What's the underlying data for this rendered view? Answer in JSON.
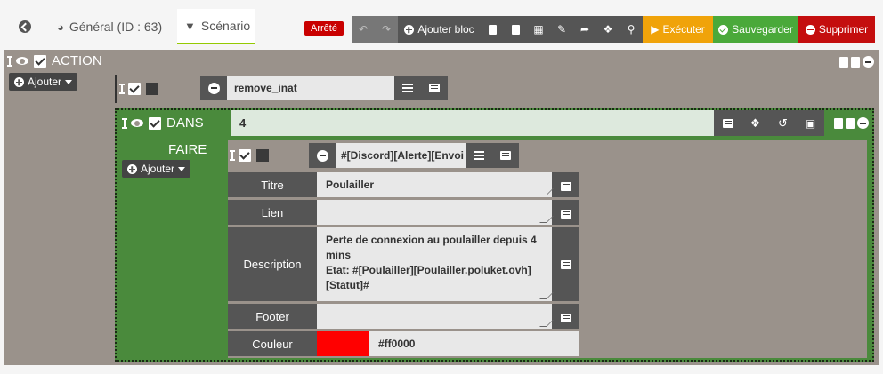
{
  "tabs": {
    "general_label": "Général (ID : 63)",
    "scenario_label": "Scénario"
  },
  "state_badge": "Arrêté",
  "toolbar": {
    "add_block_label": "Ajouter bloc",
    "execute_label": "Exécuter",
    "save_label": "Sauvegarder",
    "delete_label": "Supprimer"
  },
  "action_block": {
    "title": "ACTION",
    "add_label": "Ajouter",
    "command": "remove_inat"
  },
  "dans_block": {
    "title": "DANS",
    "condition": "4",
    "faire_label": "FAIRE",
    "add_label": "Ajouter",
    "command": "#[Discord][Alerte][Envoi",
    "params": [
      {
        "label": "Titre",
        "value": "Poulailler"
      },
      {
        "label": "Lien",
        "value": ""
      },
      {
        "label": "Description",
        "value": "Perte de connexion au poulailler depuis 4 mins\nEtat: #[Poulailler][Poulailler.poluket.ovh][Statut]#"
      },
      {
        "label": "Footer",
        "value": ""
      }
    ],
    "color_label": "Couleur",
    "color_value": "#ff0000"
  },
  "colors": {
    "accent_green": "#4a8a3c",
    "workspace": "#9a928b",
    "execute": "#f0a30a",
    "save": "#4aa93a",
    "delete": "#c40e0e"
  }
}
